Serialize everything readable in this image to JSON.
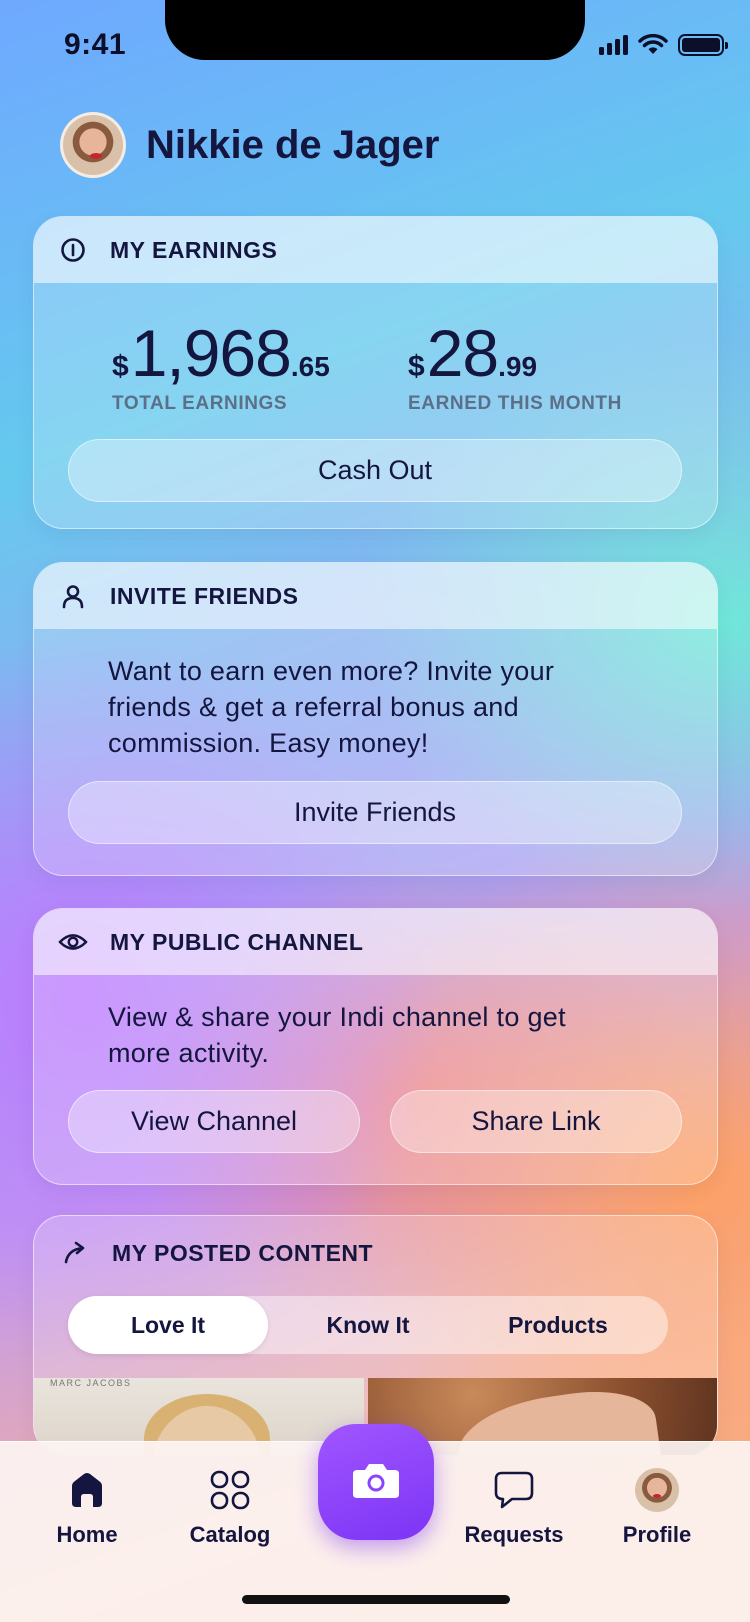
{
  "status_bar": {
    "time": "9:41"
  },
  "user": {
    "name": "Nikkie de Jager"
  },
  "earnings": {
    "title": "MY EARNINGS",
    "total": {
      "currency": "$",
      "whole": "1,968",
      "cents": ".65",
      "label": "TOTAL EARNINGS"
    },
    "month": {
      "currency": "$",
      "whole": "28",
      "cents": ".99",
      "label": "EARNED THIS MONTH"
    },
    "cash_out_label": "Cash Out"
  },
  "invite": {
    "title": "INVITE FRIENDS",
    "description": "Want to earn even more? Invite your friends & get a referral bonus and commission. Easy money!",
    "button_label": "Invite Friends"
  },
  "channel": {
    "title": "MY PUBLIC CHANNEL",
    "description": "View & share your Indi channel to get more activity.",
    "view_label": "View Channel",
    "share_label": "Share Link"
  },
  "posted": {
    "title": "MY POSTED CONTENT",
    "tabs": [
      {
        "label": "Love It",
        "active": true
      },
      {
        "label": "Know It",
        "active": false
      },
      {
        "label": "Products",
        "active": false
      }
    ],
    "thumb_brand": "MARC JACOBS"
  },
  "nav": {
    "items": [
      {
        "label": "Home",
        "icon": "home-icon"
      },
      {
        "label": "Catalog",
        "icon": "grid-icon"
      },
      {
        "label": "",
        "icon": "camera-icon"
      },
      {
        "label": "Requests",
        "icon": "chat-bubble-icon"
      },
      {
        "label": "Profile",
        "icon": "avatar"
      }
    ]
  },
  "colors": {
    "text": "#14163f",
    "accent": "#8c44fa",
    "label_muted": "#5c6f88"
  }
}
